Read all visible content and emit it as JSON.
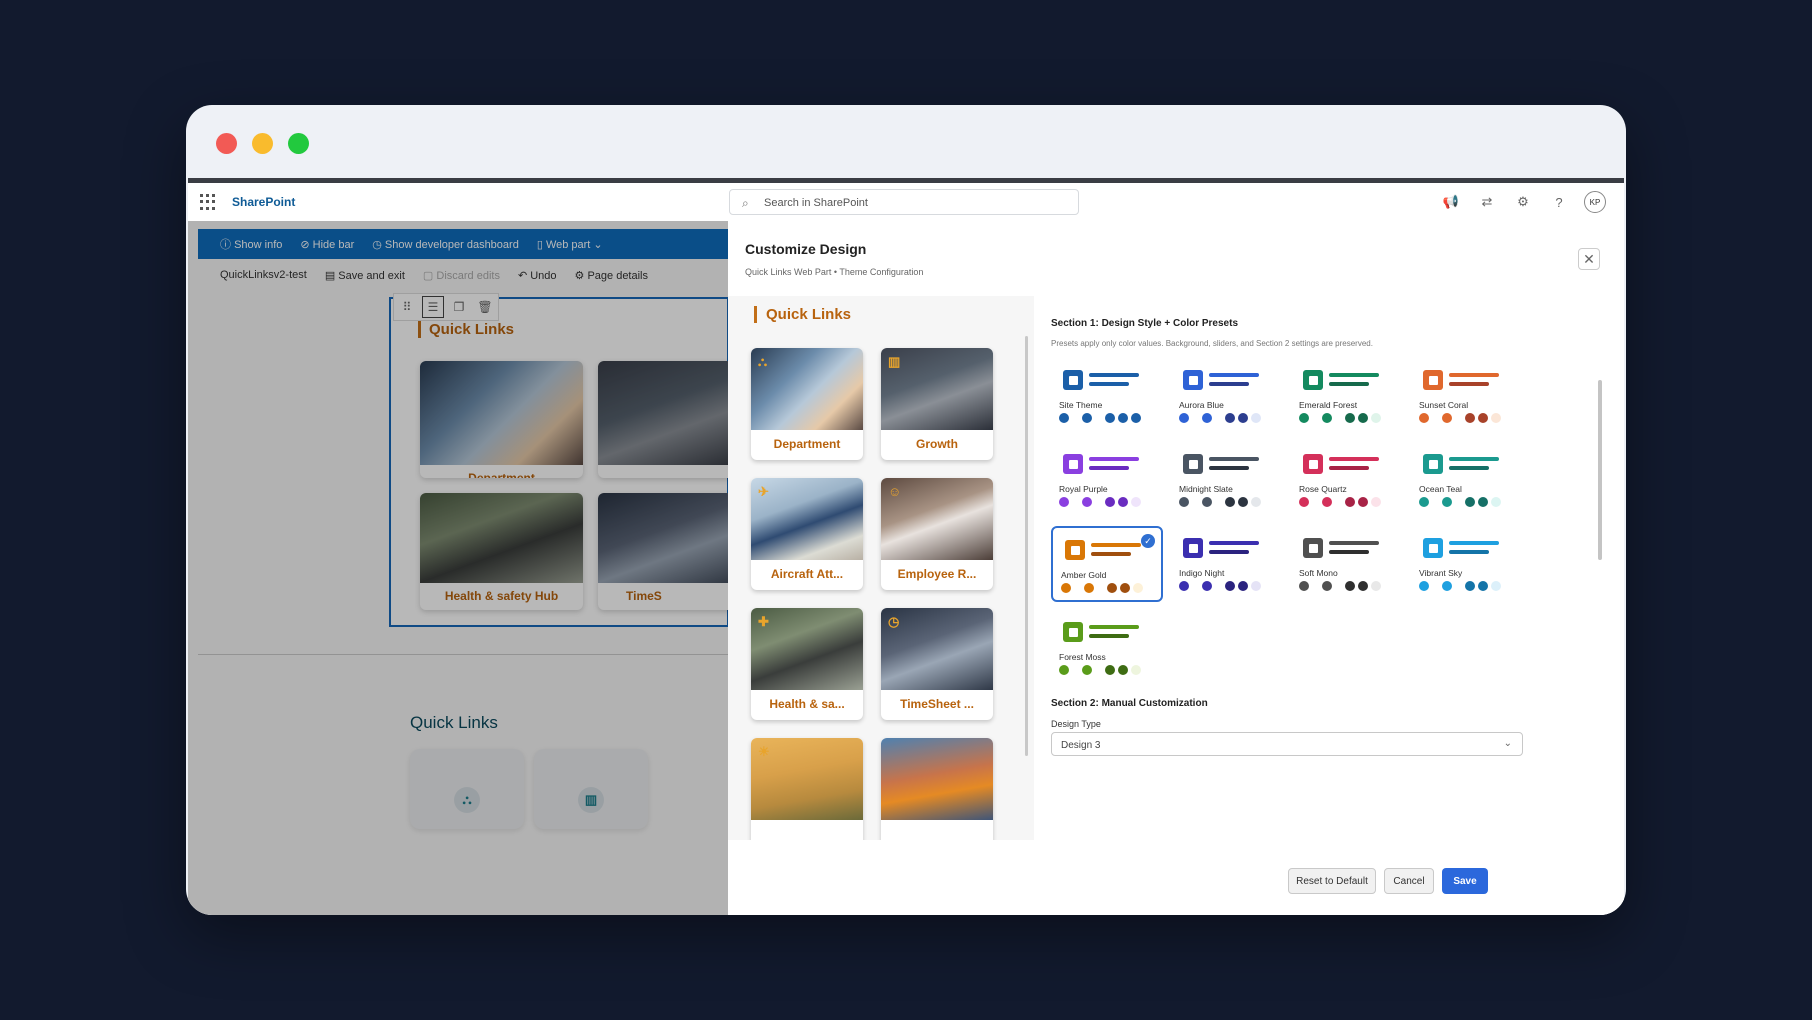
{
  "suite": {
    "brand": "SharePoint",
    "search_placeholder": "Search in SharePoint",
    "avatar": "KP"
  },
  "devbar": {
    "show_info": "Show info",
    "hide_bar": "Hide bar",
    "dev_dashboard": "Show developer dashboard",
    "web_part": "Web part"
  },
  "cmdbar": {
    "page": "QuickLinksv2-test",
    "save_exit": "Save and exit",
    "discard": "Discard edits",
    "undo": "Undo",
    "page_details": "Page details"
  },
  "bg": {
    "title": "Quick Links",
    "cards": [
      "Department",
      "",
      "Health & safety Hub",
      "TimeS"
    ],
    "section2_title": "Quick Links"
  },
  "panel": {
    "title": "Customize Design",
    "subtitle": "Quick Links Web Part • Theme Configuration"
  },
  "preview": {
    "title": "Quick Links",
    "cards": [
      "Department",
      "Growth",
      "Aircraft Att...",
      "Employee R...",
      "Health & sa...",
      "TimeSheet ...",
      "",
      ""
    ]
  },
  "section1": {
    "heading": "Section 1: Design Style + Color Presets",
    "desc": "Presets apply only color values. Background, sliders, and Section 2 settings are preserved."
  },
  "presets": [
    {
      "name": "Site Theme",
      "colors": [
        "#1b5fa8",
        "#1b5fa8",
        "#1b5fa8",
        "#1b5fa8",
        "#1b5fa8"
      ]
    },
    {
      "name": "Aurora Blue",
      "colors": [
        "#2e62d6",
        "#2e62d6",
        "#2c3e8f",
        "#2c3e8f",
        "#dfe6f7"
      ]
    },
    {
      "name": "Emerald Forest",
      "colors": [
        "#148a5f",
        "#148a5f",
        "#166a4c",
        "#166a4c",
        "#dff4ea"
      ]
    },
    {
      "name": "Sunset Coral",
      "colors": [
        "#e0682d",
        "#e0682d",
        "#a8422a",
        "#a8422a",
        "#fbe6d7"
      ]
    },
    {
      "name": "Royal Purple",
      "colors": [
        "#8a3fe0",
        "#8a3fe0",
        "#6a2cc0",
        "#6a2cc0",
        "#efe4fb"
      ]
    },
    {
      "name": "Midnight Slate",
      "colors": [
        "#4a5563",
        "#4a5563",
        "#2c3440",
        "#2c3440",
        "#e4e7eb"
      ]
    },
    {
      "name": "Rose Quartz",
      "colors": [
        "#d4305a",
        "#d4305a",
        "#a82346",
        "#a82346",
        "#fbe2e9"
      ]
    },
    {
      "name": "Ocean Teal",
      "colors": [
        "#1b9a8f",
        "#1b9a8f",
        "#167067",
        "#167067",
        "#dcf5f2"
      ]
    },
    {
      "name": "Amber Gold",
      "colors": [
        "#d97706",
        "#d97706",
        "#a04f0e",
        "#a04f0e",
        "#fdf1d8"
      ],
      "selected": true
    },
    {
      "name": "Indigo Night",
      "colors": [
        "#3b2fb0",
        "#3b2fb0",
        "#2b237f",
        "#2b237f",
        "#e5e3f6"
      ]
    },
    {
      "name": "Soft Mono",
      "colors": [
        "#505050",
        "#505050",
        "#2f2f2f",
        "#2f2f2f",
        "#e8e8e8"
      ]
    },
    {
      "name": "Vibrant Sky",
      "colors": [
        "#1ea0e0",
        "#1ea0e0",
        "#1474a8",
        "#1474a8",
        "#dcf0fa"
      ]
    },
    {
      "name": "Forest Moss",
      "colors": [
        "#5a9c1a",
        "#5a9c1a",
        "#3e6c13",
        "#3e6c13",
        "#eef5de"
      ]
    }
  ],
  "section2": {
    "heading": "Section 2: Manual Customization",
    "design_type_label": "Design Type",
    "design_type_value": "Design 3"
  },
  "buttons": {
    "reset": "Reset to Default",
    "cancel": "Cancel",
    "save": "Save"
  },
  "colors": {
    "primary": "#2b68dc",
    "accent": "#b8630e",
    "devbar": "#0f6cbd"
  }
}
